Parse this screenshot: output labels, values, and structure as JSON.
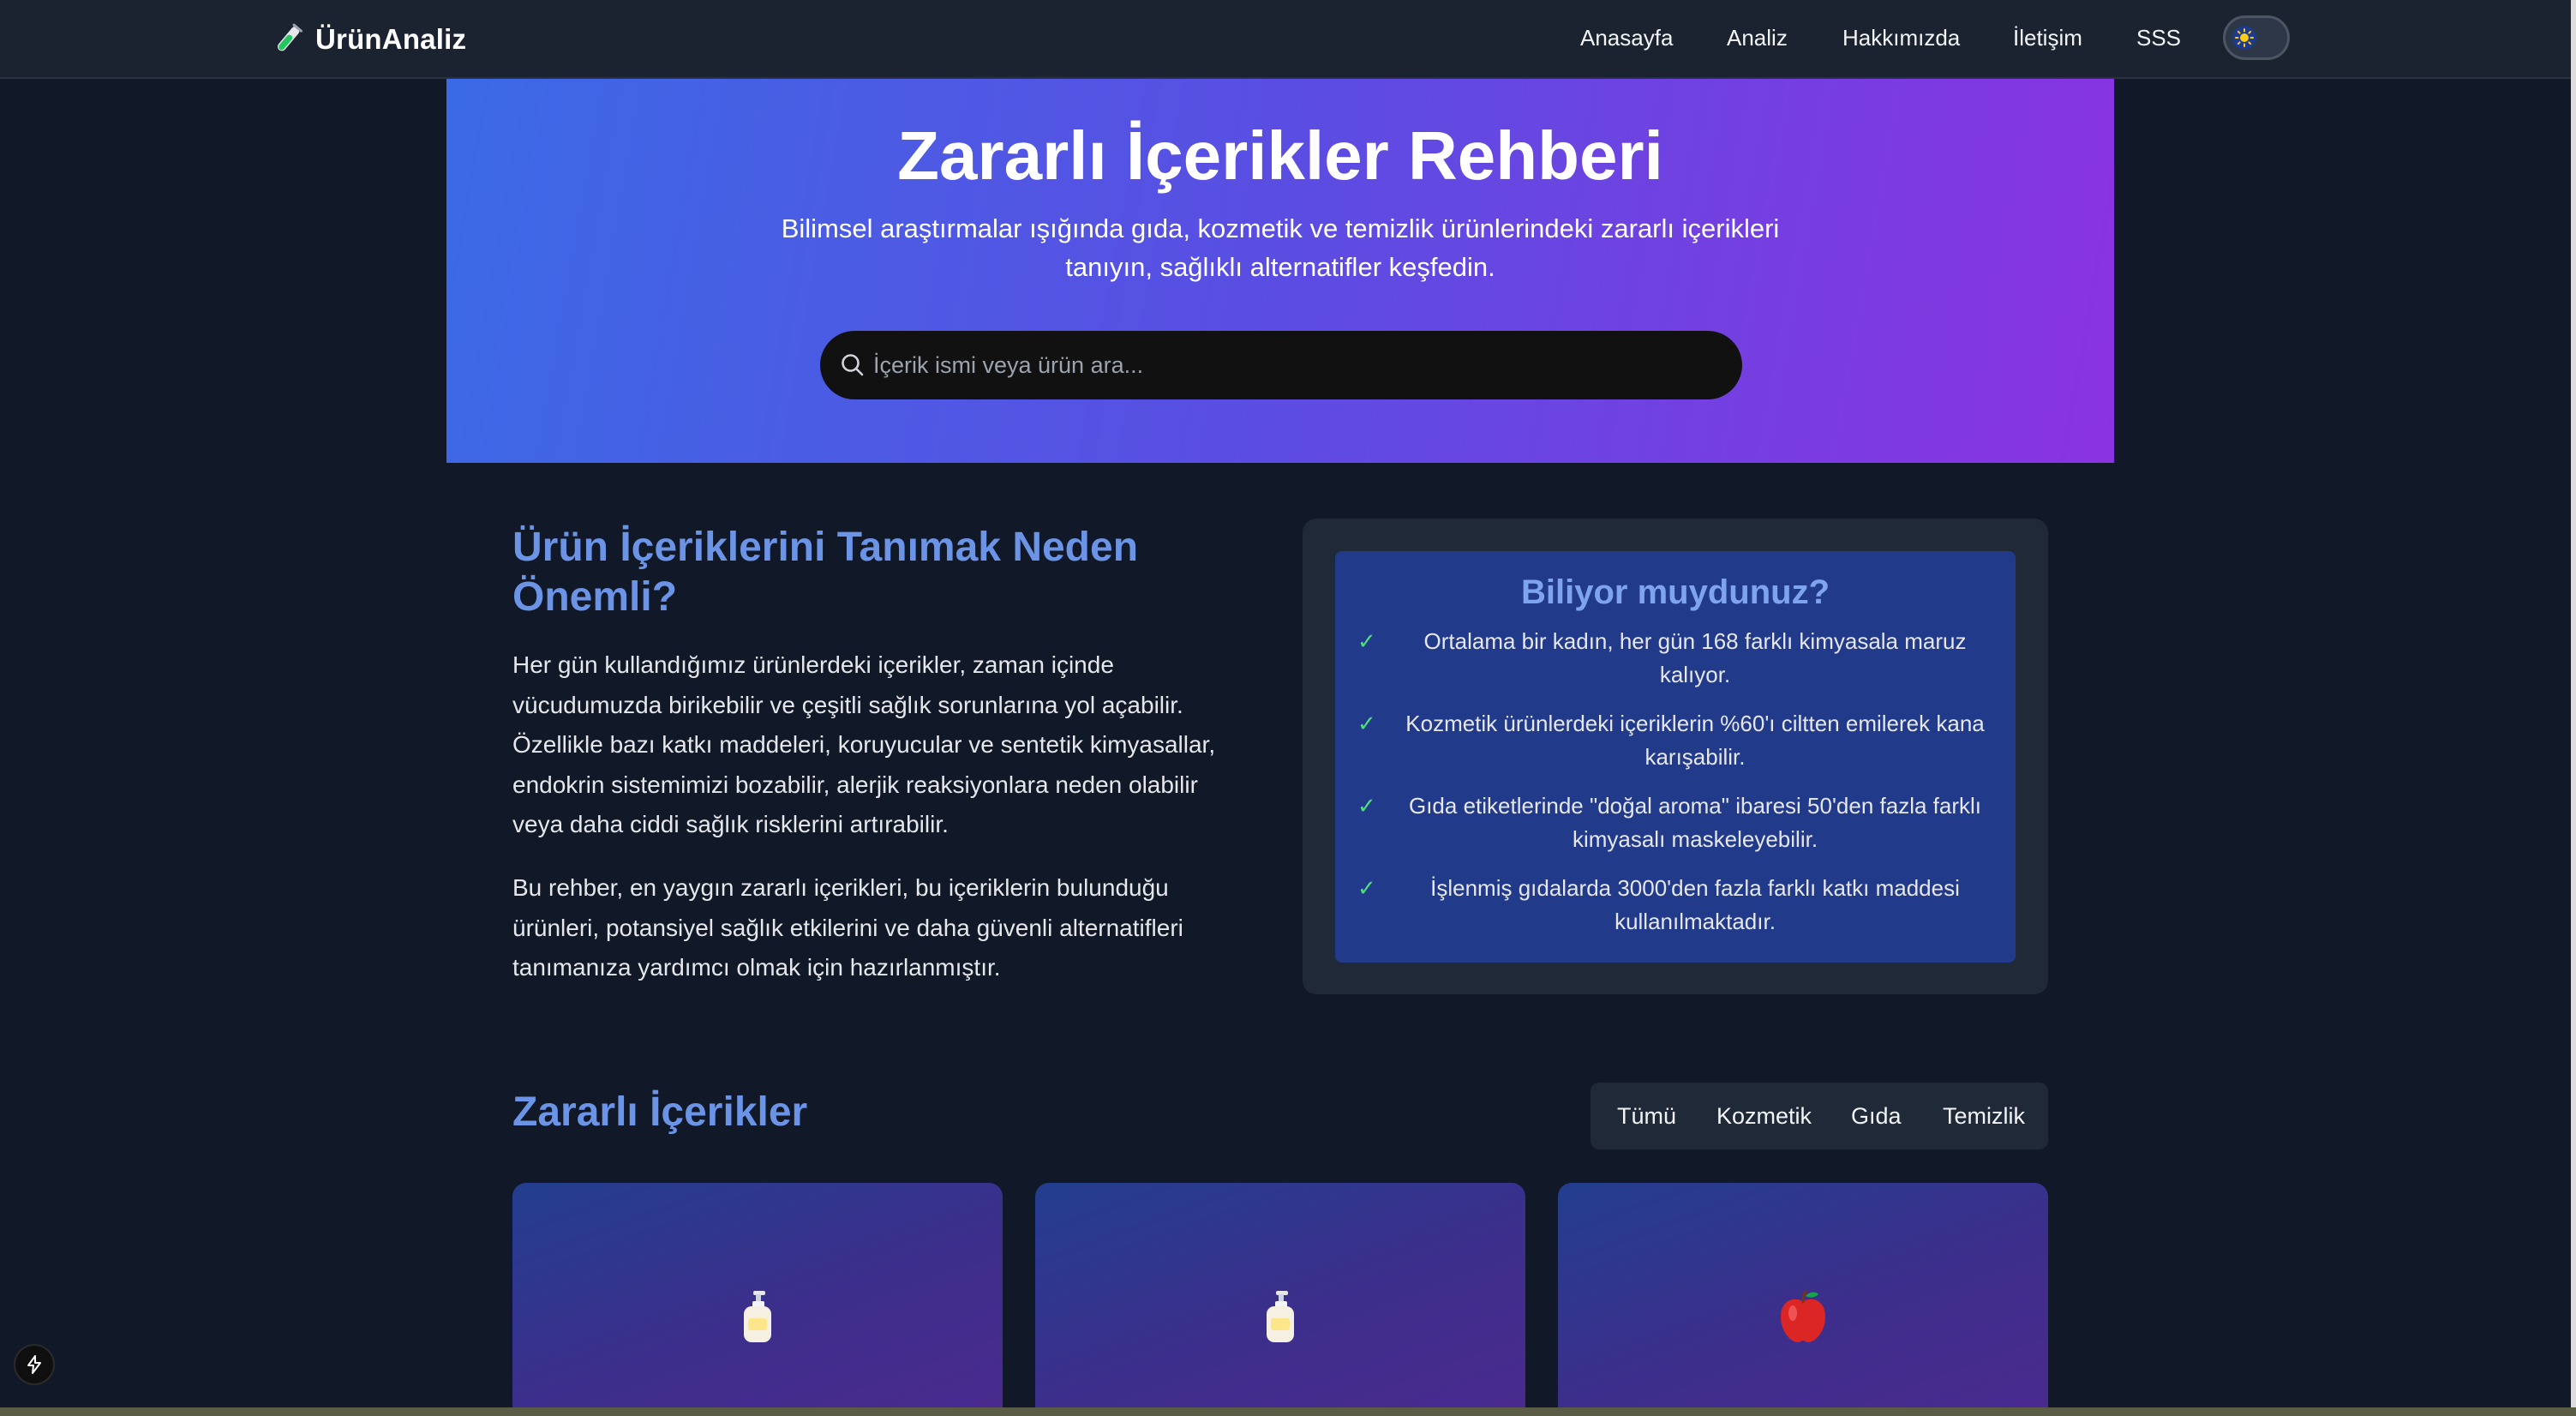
{
  "colors": {
    "page_background": "#111827",
    "navbar_background": "#1c2330",
    "heading_accent": "#6b93e6",
    "hero_gradient_start": "#3b6ae6",
    "hero_gradient_end": "#8a33e0",
    "check_mark": "#4ade80",
    "info_box": "#223a8a"
  },
  "navbar": {
    "brand": "ÜrünAnaliz",
    "brand_icon": "test-tube-icon",
    "links": [
      "Anasayfa",
      "Analiz",
      "Hakkımızda",
      "İletişim",
      "SSS"
    ],
    "theme_toggle_icon": "sun-icon"
  },
  "hero": {
    "title": "Zararlı İçerikler Rehberi",
    "subtitle_line1": "Bilimsel araştırmalar ışığında gıda, kozmetik ve temizlik ürünlerindeki zararlı içerikleri",
    "subtitle_line2": "tanıyın, sağlıklı alternatifler keşfedin.",
    "search_placeholder": "İçerik ismi veya ürün ara...",
    "search_icon": "search-icon"
  },
  "intro": {
    "title": "Ürün İçeriklerini Tanımak Neden Önemli?",
    "paragraph1": "Her gün kullandığımız ürünlerdeki içerikler, zaman içinde vücudumuzda birikebilir ve çeşitli sağlık sorunlarına yol açabilir. Özellikle bazı katkı maddeleri, koruyucular ve sentetik kimyasallar, endokrin sistemimizi bozabilir, alerjik reaksiyonlara neden olabilir veya daha ciddi sağlık risklerini artırabilir.",
    "paragraph2": "Bu rehber, en yaygın zararlı içerikleri, bu içeriklerin bulunduğu ürünleri, potansiyel sağlık etkilerini ve daha güvenli alternatifleri tanımanıza yardımcı olmak için hazırlanmıştır."
  },
  "did_you_know": {
    "title": "Biliyor muydunuz?",
    "check": "✓",
    "facts": [
      "Ortalama bir kadın, her gün 168 farklı kimyasala maruz kalıyor.",
      "Kozmetik ürünlerdeki içeriklerin %60'ı ciltten emilerek kana karışabilir.",
      "Gıda etiketlerinde \"doğal aroma\" ibaresi 50'den fazla farklı kimyasalı maskeleyebilir.",
      "İşlenmiş gıdalarda 3000'den fazla farklı katkı maddesi kullanılmaktadır."
    ]
  },
  "harmful": {
    "title": "Zararlı İçerikler",
    "filters": [
      "Tümü",
      "Kozmetik",
      "Gıda",
      "Temizlik"
    ],
    "cards": [
      {
        "icon": "lotion-bottle-icon"
      },
      {
        "icon": "lotion-bottle-icon"
      },
      {
        "icon": "red-apple-icon"
      }
    ]
  },
  "floating_button_icon": "lightning-bolt-icon"
}
